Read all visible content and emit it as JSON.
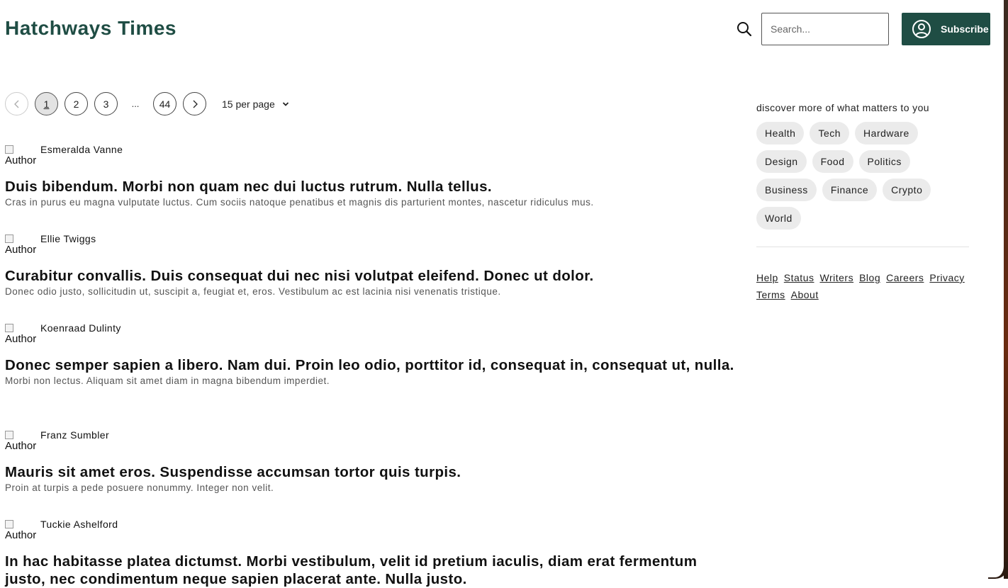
{
  "header": {
    "logo": "Hatchways Times",
    "search_placeholder": "Search...",
    "search_icon": "search-icon",
    "subscribe_label": "Subscribe",
    "subscribe_icon": "user-circle-icon",
    "brand_color": "#1f4d44"
  },
  "pagination": {
    "pages": [
      "1",
      "2",
      "3"
    ],
    "active_page": "1",
    "ellipsis": "...",
    "last_page": "44",
    "per_page_label": "15 per page"
  },
  "posts": [
    {
      "avatar_alt": "Author",
      "author": "Esmeralda Vanne",
      "title": "Duis bibendum. Morbi non quam nec dui luctus rutrum. Nulla tellus.",
      "summary": "Cras in purus eu magna vulputate luctus. Cum sociis natoque penatibus et magnis dis parturient montes, nascetur ridiculus mus."
    },
    {
      "avatar_alt": "Author",
      "author": "Ellie Twiggs",
      "title": "Curabitur convallis. Duis consequat dui nec nisi volutpat eleifend. Donec ut dolor.",
      "summary": "Donec odio justo, sollicitudin ut, suscipit a, feugiat et, eros. Vestibulum ac est lacinia nisi venenatis tristique."
    },
    {
      "avatar_alt": "Author",
      "author": "Koenraad Dulinty",
      "title": "Donec semper sapien a libero. Nam dui. Proin leo odio, porttitor id, consequat in, consequat ut, nulla.",
      "summary": "Morbi non lectus. Aliquam sit amet diam in magna bibendum imperdiet."
    },
    {
      "avatar_alt": "Author",
      "author": "Franz Sumbler",
      "title": "Mauris sit amet eros. Suspendisse accumsan tortor quis turpis.",
      "summary": "Proin at turpis a pede posuere nonummy. Integer non velit."
    },
    {
      "avatar_alt": "Author",
      "author": "Tuckie Ashelford",
      "title": "In hac habitasse platea dictumst. Morbi vestibulum, velit id pretium iaculis, diam erat fermentum justo, nec condimentum neque sapien placerat ante. Nulla justo.",
      "summary": ""
    }
  ],
  "sidebar": {
    "discover_label": "discover more of what matters to you",
    "tags": [
      "Health",
      "Tech",
      "Hardware",
      "Design",
      "Food",
      "Politics",
      "Business",
      "Finance",
      "Crypto",
      "World"
    ],
    "footer_links": [
      "Help",
      "Status",
      "Writers",
      "Blog",
      "Careers",
      "Privacy",
      "Terms",
      "About"
    ]
  }
}
